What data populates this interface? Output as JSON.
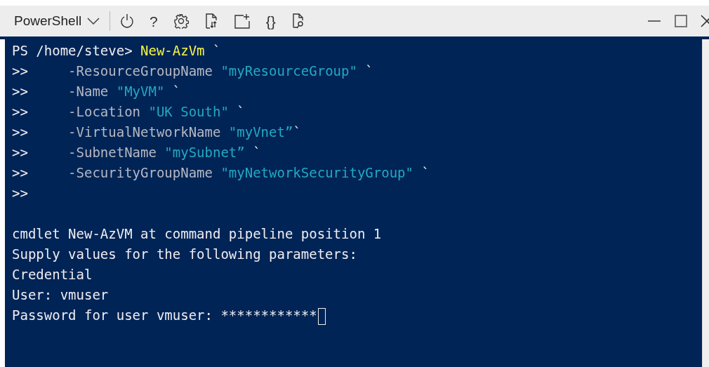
{
  "shell_selector": {
    "label": "PowerShell"
  },
  "toolbar": [
    {
      "kind": "power"
    },
    {
      "kind": "glyph",
      "label": "?"
    },
    {
      "kind": "gear"
    },
    {
      "kind": "transfer"
    },
    {
      "kind": "newwindow"
    },
    {
      "kind": "glyph",
      "label": "{}"
    },
    {
      "kind": "preview"
    }
  ],
  "window_controls": [
    {
      "kind": "minimize"
    },
    {
      "kind": "maximize"
    },
    {
      "kind": "close"
    }
  ],
  "terminal": {
    "lines": [
      [
        {
          "kind": "prompt",
          "text": "PS /home/steve> "
        },
        {
          "kind": "command",
          "text": "New-AzVm"
        },
        {
          "kind": "tick",
          "text": " `"
        }
      ],
      [
        {
          "kind": "prompt",
          "text": ">>     "
        },
        {
          "kind": "param",
          "text": "-ResourceGroupName "
        },
        {
          "kind": "string",
          "text": "\"myResourceGroup\""
        },
        {
          "kind": "tick",
          "text": " `"
        }
      ],
      [
        {
          "kind": "prompt",
          "text": ">>     "
        },
        {
          "kind": "param",
          "text": "-Name "
        },
        {
          "kind": "string",
          "text": "\"MyVM\""
        },
        {
          "kind": "tick",
          "text": " `"
        }
      ],
      [
        {
          "kind": "prompt",
          "text": ">>     "
        },
        {
          "kind": "param",
          "text": "-Location "
        },
        {
          "kind": "string",
          "text": "\"UK South\""
        },
        {
          "kind": "tick",
          "text": " `"
        }
      ],
      [
        {
          "kind": "prompt",
          "text": ">>     "
        },
        {
          "kind": "param",
          "text": "-VirtualNetworkName "
        },
        {
          "kind": "string",
          "text": "\"myVnet”"
        },
        {
          "kind": "tick",
          "text": "`"
        }
      ],
      [
        {
          "kind": "prompt",
          "text": ">>     "
        },
        {
          "kind": "param",
          "text": "-SubnetName "
        },
        {
          "kind": "string",
          "text": "\"mySubnet”"
        },
        {
          "kind": "tick",
          "text": " `"
        }
      ],
      [
        {
          "kind": "prompt",
          "text": ">>     "
        },
        {
          "kind": "param",
          "text": "-SecurityGroupName "
        },
        {
          "kind": "string",
          "text": "\"myNetworkSecurityGroup\""
        },
        {
          "kind": "tick",
          "text": " `"
        }
      ],
      [
        {
          "kind": "prompt",
          "text": ">>"
        }
      ],
      {
        "kind": "blank"
      },
      [
        {
          "kind": "output",
          "text": "cmdlet New-AzVM at command pipeline position 1"
        }
      ],
      [
        {
          "kind": "output",
          "text": "Supply values for the following parameters:"
        }
      ],
      [
        {
          "kind": "output",
          "text": "Credential"
        }
      ],
      [
        {
          "kind": "output",
          "text": "User: vmuser"
        }
      ],
      [
        {
          "kind": "output",
          "text": "Password for user vmuser: ************"
        }
      ]
    ],
    "cursor_visible": true
  }
}
